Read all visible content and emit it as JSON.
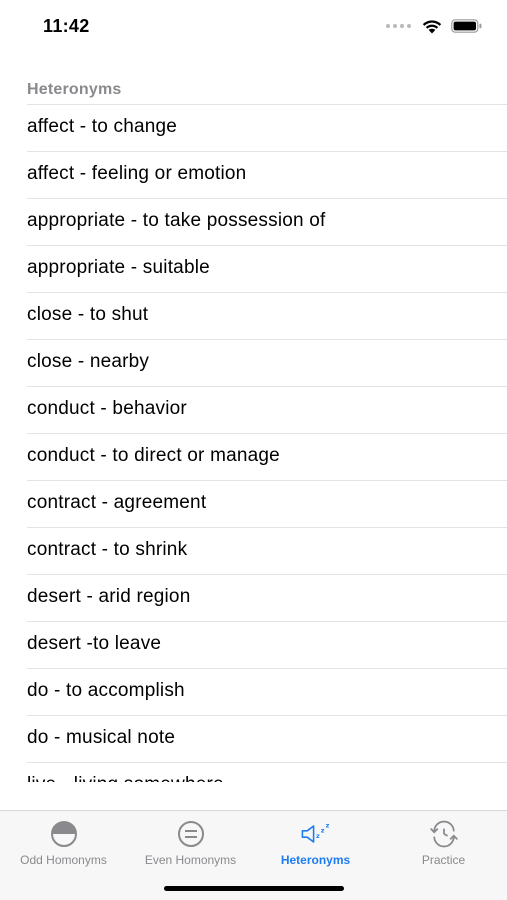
{
  "status_bar": {
    "time": "11:42"
  },
  "list": {
    "section_header": "Heteronyms",
    "items": [
      "affect - to change",
      "affect - feeling or emotion",
      "appropriate - to take possession of",
      "appropriate - suitable",
      "close - to shut",
      "close - nearby",
      "conduct - behavior",
      "conduct - to direct or manage",
      "contract - agreement",
      "contract - to shrink",
      "desert - arid region",
      "desert -to leave",
      "do - to accomplish",
      "do - musical note",
      "live - living somewhere"
    ]
  },
  "tab_bar": {
    "tabs": [
      {
        "label": "Odd Homonyms",
        "icon": "half-circle-icon",
        "active": false
      },
      {
        "label": "Even Homonyms",
        "icon": "equal-circle-icon",
        "active": false
      },
      {
        "label": "Heteronyms",
        "icon": "speaker-zzz-icon",
        "active": true
      },
      {
        "label": "Practice",
        "icon": "clock-arrows-icon",
        "active": false
      }
    ],
    "accent_color": "#1e7cf2",
    "inactive_color": "#8a8a8e"
  }
}
